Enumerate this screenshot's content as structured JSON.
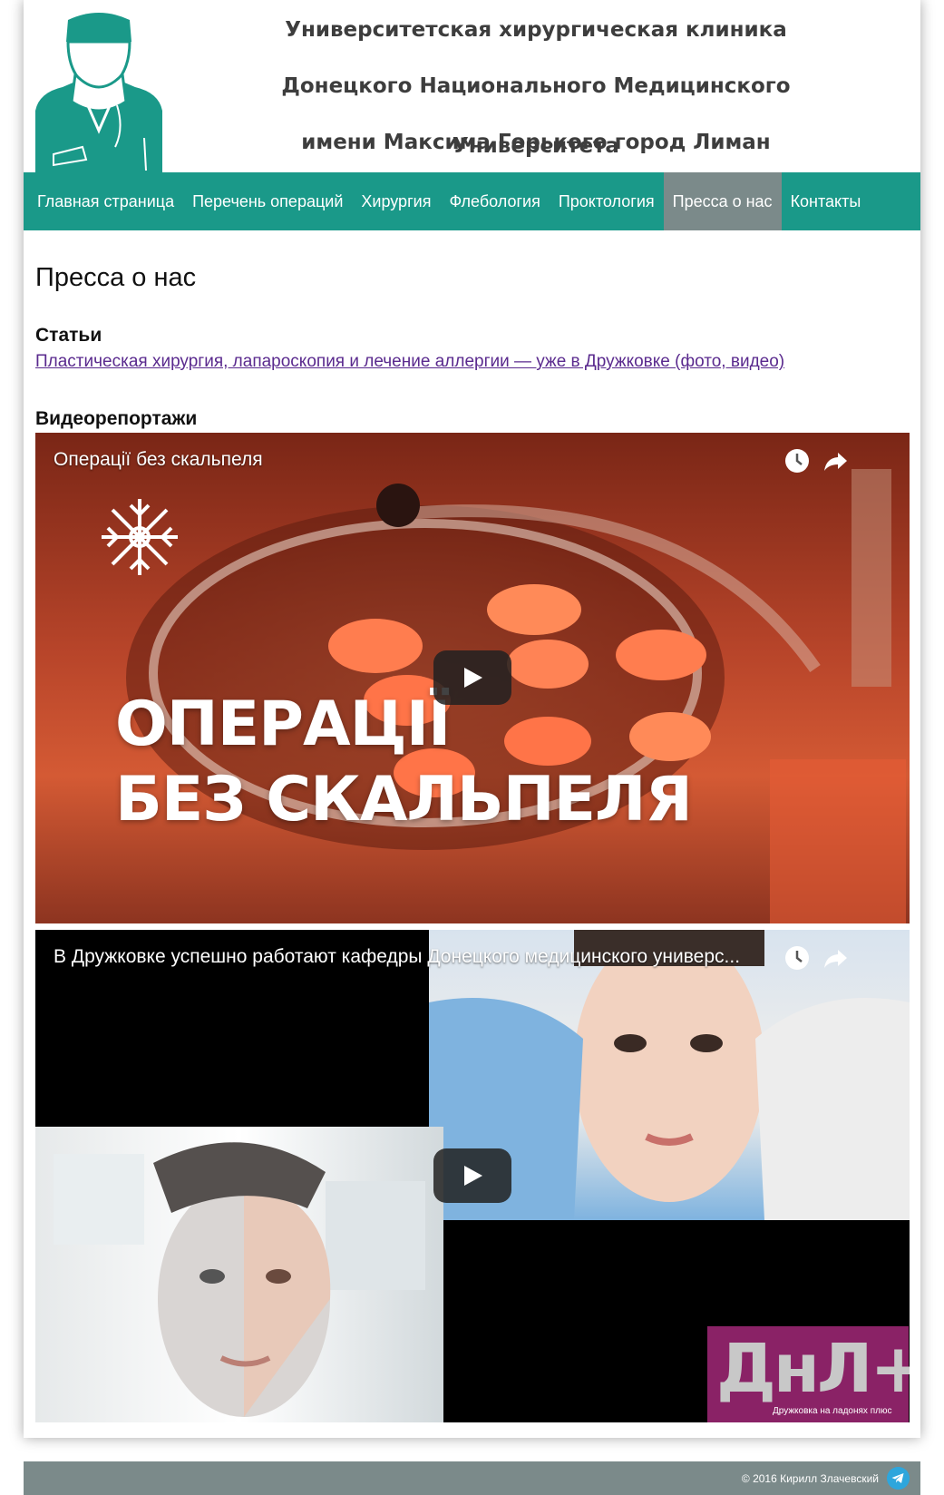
{
  "header": {
    "title_lines": [
      "Университетская хирургическая клиника",
      "Донецкого Национального Медицинского Университета",
      "имени Максима Горького город Лиман"
    ]
  },
  "nav": {
    "items": [
      {
        "label": "Главная страница"
      },
      {
        "label": "Перечень операций"
      },
      {
        "label": "Хирургия"
      },
      {
        "label": "Флебология"
      },
      {
        "label": "Проктология"
      },
      {
        "label": "Пресса о нас",
        "active": true
      },
      {
        "label": "Контакты"
      }
    ]
  },
  "main": {
    "page_title": "Пресса о нас",
    "articles": {
      "heading": "Статьи",
      "links": [
        "Пластическая хирургия, лапароскопия и лечение аллергии — уже в Дружковке (фото, видео)"
      ]
    },
    "videos": {
      "heading": "Видеорепортажи",
      "items": [
        {
          "title": "Операції без скальпеля",
          "overlay_line1": "ОПЕРАЦІЇ",
          "overlay_line2": "БЕЗ СКАЛЬПЕЛЯ"
        },
        {
          "title": "В Дружковке успешно работают кафедры Донецкого медицинского универс...",
          "logo_text": "ДнЛ+",
          "logo_caption": "Дружковка на ладонях плюс"
        }
      ]
    }
  },
  "footer": {
    "copyright": "© 2016 Кирилл Злачевский"
  },
  "colors": {
    "brand_teal": "#1a9989",
    "nav_active": "#7b8a8a",
    "footer_bg": "#7b8a8a",
    "link": "#5a2a8e"
  },
  "icons": [
    "surgeon-logo-icon",
    "clock-icon",
    "share-icon",
    "play-icon",
    "telegram-icon"
  ]
}
